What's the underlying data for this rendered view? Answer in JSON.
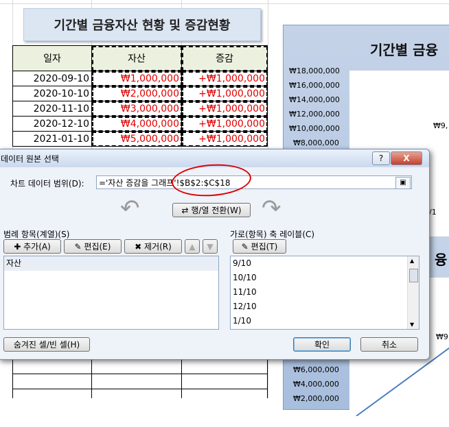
{
  "sheet": {
    "title": "기간별 금융자산 현황 및 증감현황",
    "headers": [
      "일자",
      "자산",
      "증감"
    ],
    "rows": [
      [
        "2020-09-10",
        "₩1,000,000",
        "+₩1,000,000"
      ],
      [
        "2020-10-10",
        "₩2,000,000",
        "+₩1,000,000"
      ],
      [
        "2020-11-10",
        "₩3,000,000",
        "+₩1,000,000"
      ],
      [
        "2020-12-10",
        "₩4,000,000",
        "+₩1,000,000"
      ],
      [
        "2021-01-10",
        "₩5,000,000",
        "+₩1,000,000"
      ]
    ]
  },
  "chart": {
    "title": "기간별 금융",
    "title_lower": "융",
    "yticks_top": [
      "₩18,000,000",
      "₩16,000,000",
      "₩14,000,000",
      "₩12,000,000",
      "₩10,000,000",
      "₩8,000,000"
    ],
    "yticks_bottom": [
      "₩6,000,000",
      "₩4,000,000",
      "₩2,000,000"
    ],
    "data_label_1": "₩9,",
    "data_label_2": "₩9,",
    "axis_partial": "/1"
  },
  "dialog": {
    "title": "데이터 원본 선택",
    "help": "?",
    "close": "X",
    "range_label": "차트 데이터 범위(D):",
    "range_value": "='자산 증감을 그래프'!$B$2:$C$18",
    "switch_button": "행/열 전환(W)",
    "legend_label": "범례 항목(계열)(S)",
    "legend_add": "추가(A)",
    "legend_edit": "편집(E)",
    "legend_remove": "제거(R)",
    "legend_items": [
      "자산"
    ],
    "axis_label": "가로(항목) 축 레이블(C)",
    "axis_edit": "편집(T)",
    "axis_items": [
      "9/10",
      "10/10",
      "11/10",
      "12/10",
      "1/10"
    ],
    "hidden_cells": "숨겨진 셀/빈 셀(H)",
    "ok": "확인",
    "cancel": "취소"
  }
}
